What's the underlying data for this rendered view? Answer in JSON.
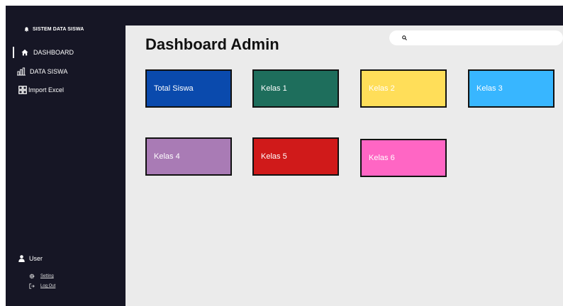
{
  "sidebar": {
    "brand": "SISTEM DATA SISWA",
    "items": [
      {
        "label": "DASHBOARD",
        "icon": "home-icon"
      },
      {
        "label": "DATA SISWA",
        "icon": "bar-chart-icon"
      },
      {
        "label": "Import Excel",
        "icon": "grid-icon"
      }
    ],
    "user": {
      "label": "User",
      "icon": "user-icon"
    },
    "settings": "Setting",
    "logout": "Log Out"
  },
  "main": {
    "title": "Dashboard Admin",
    "search": {
      "placeholder": "",
      "value": ""
    },
    "cards": [
      {
        "label": "Total Siswa",
        "color": "#0a4aad"
      },
      {
        "label": "Kelas 1",
        "color": "#1e6e5c"
      },
      {
        "label": "Kelas 2",
        "color": "#ffde59"
      },
      {
        "label": "Kelas 3",
        "color": "#38b6ff"
      },
      {
        "label": "Kelas 4",
        "color": "#a97bb5"
      },
      {
        "label": "Kelas 5",
        "color": "#d01a1a"
      },
      {
        "label": "Kelas 6",
        "color": "#ff66c4"
      }
    ]
  },
  "colors": {
    "sidebar_bg": "#161625",
    "main_bg": "#ebebeb"
  }
}
